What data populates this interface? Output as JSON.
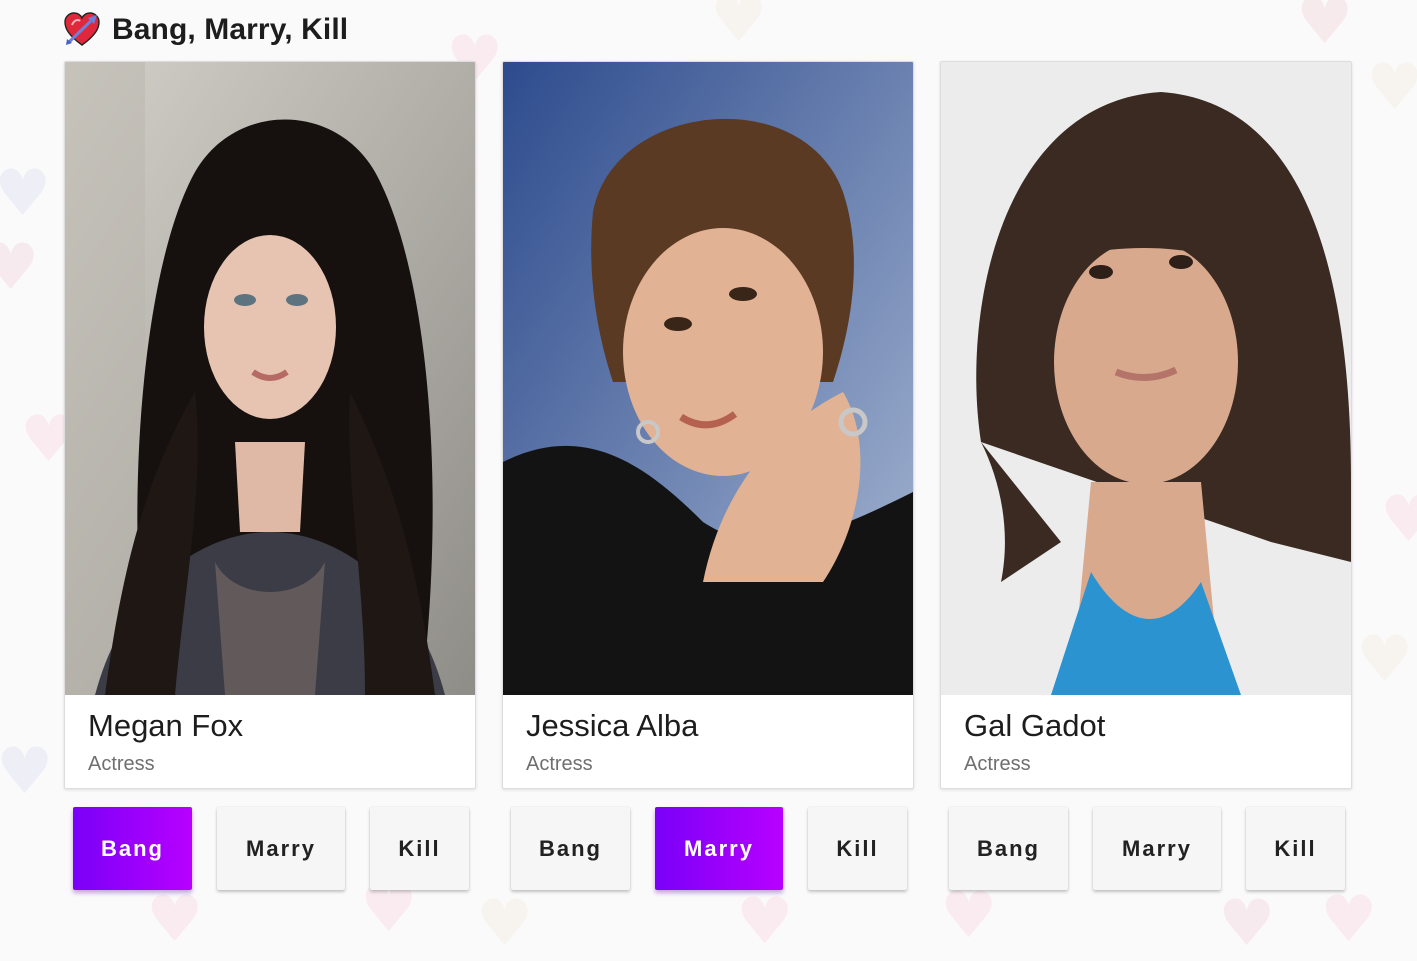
{
  "app": {
    "title": "Bang, Marry, Kill",
    "icon": "heart-arrow-icon"
  },
  "options": [
    "Bang",
    "Marry",
    "Kill"
  ],
  "colors": {
    "accent_start": "#7a00f7",
    "accent_end": "#b800ff",
    "button_bg": "#f6f6f6",
    "card_bg": "#ffffff",
    "background": "#fbfafb"
  },
  "cards": [
    {
      "name": "Megan Fox",
      "role": "Actress",
      "selected": "Bang",
      "buttons": [
        "Bang",
        "Marry",
        "Kill"
      ]
    },
    {
      "name": "Jessica Alba",
      "role": "Actress",
      "selected": "Marry",
      "buttons": [
        "Bang",
        "Marry",
        "Kill"
      ]
    },
    {
      "name": "Gal Gadot",
      "role": "Actress",
      "selected": "",
      "buttons": [
        "Bang",
        "Marry",
        "Kill"
      ]
    }
  ]
}
